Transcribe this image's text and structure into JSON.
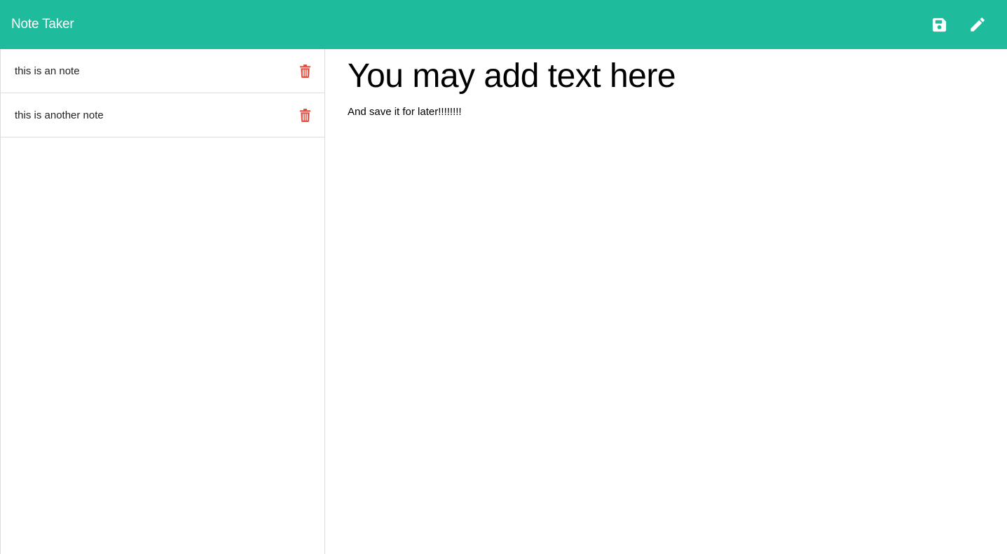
{
  "app": {
    "title": "Note Taker",
    "accent_color": "#1ebc9c",
    "delete_color": "#e74c3c"
  },
  "toolbar": {
    "save_icon": "floppy-disk-icon",
    "edit_icon": "pencil-icon"
  },
  "notes": [
    {
      "title": "this is an note",
      "delete_icon": "trash-icon"
    },
    {
      "title": "this is another note",
      "delete_icon": "trash-icon"
    }
  ],
  "active_note": {
    "title": "You may add text here",
    "text": "And save it for later!!!!!!!!"
  }
}
